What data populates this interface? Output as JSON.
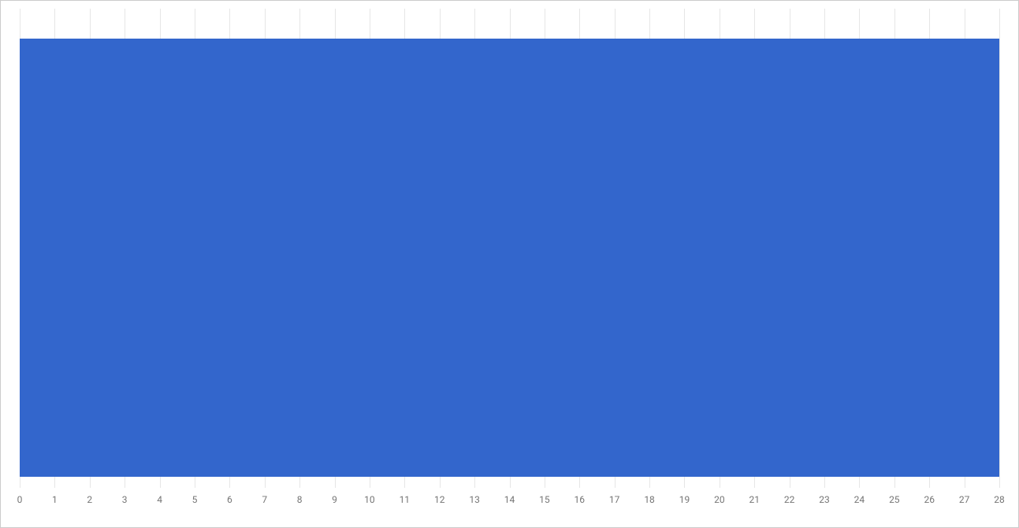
{
  "chart_data": {
    "type": "bar",
    "orientation": "horizontal",
    "categories": [
      ""
    ],
    "values": [
      28
    ],
    "xlabel": "",
    "ylabel": "",
    "title": "",
    "xlim": [
      0,
      28
    ],
    "x_ticks": [
      0,
      1,
      2,
      3,
      4,
      5,
      6,
      7,
      8,
      9,
      10,
      11,
      12,
      13,
      14,
      15,
      16,
      17,
      18,
      19,
      20,
      21,
      22,
      23,
      24,
      25,
      26,
      27,
      28
    ],
    "bar_color": "#3366cc",
    "grid": {
      "vertical": true,
      "horizontal": false
    }
  }
}
